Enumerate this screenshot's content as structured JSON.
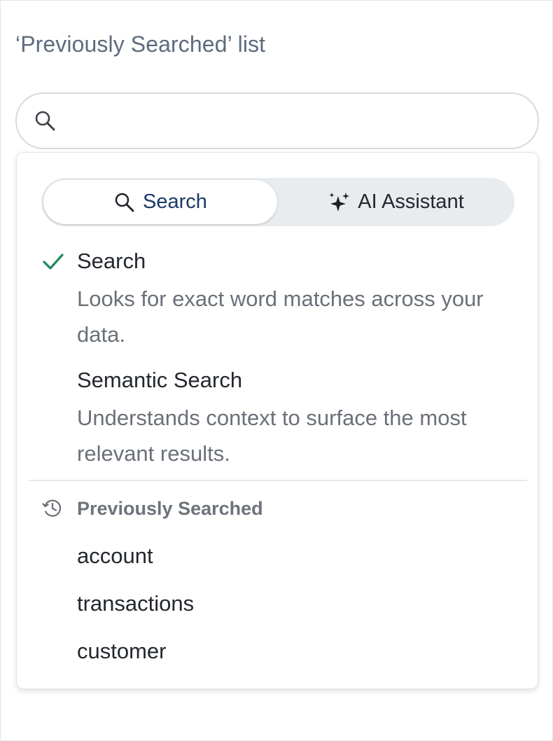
{
  "section": {
    "title": "‘Previously Searched’ list"
  },
  "search": {
    "icon": "search-icon",
    "value": "",
    "placeholder": ""
  },
  "dropdown": {
    "mode_toggle": {
      "search_label": "Search",
      "search_icon": "search-icon",
      "ai_label": "AI Assistant",
      "ai_icon": "sparkles-icon",
      "selected": "Search"
    },
    "options": [
      {
        "title": "Search",
        "description": "Looks for exact word matches across your data.",
        "selected": true
      },
      {
        "title": "Semantic Search",
        "description": "Understands context to surface the most relevant results.",
        "selected": false
      }
    ],
    "history": {
      "heading": "Previously Searched",
      "icon": "history-icon",
      "items": [
        "account",
        "transactions",
        "customer"
      ]
    }
  },
  "colors": {
    "title_text": "#5e6b7e",
    "active_tab_text": "#1b3868",
    "check_green": "#1f8a5b",
    "secondary_text": "#6b7078",
    "primary_text": "#23272e"
  }
}
